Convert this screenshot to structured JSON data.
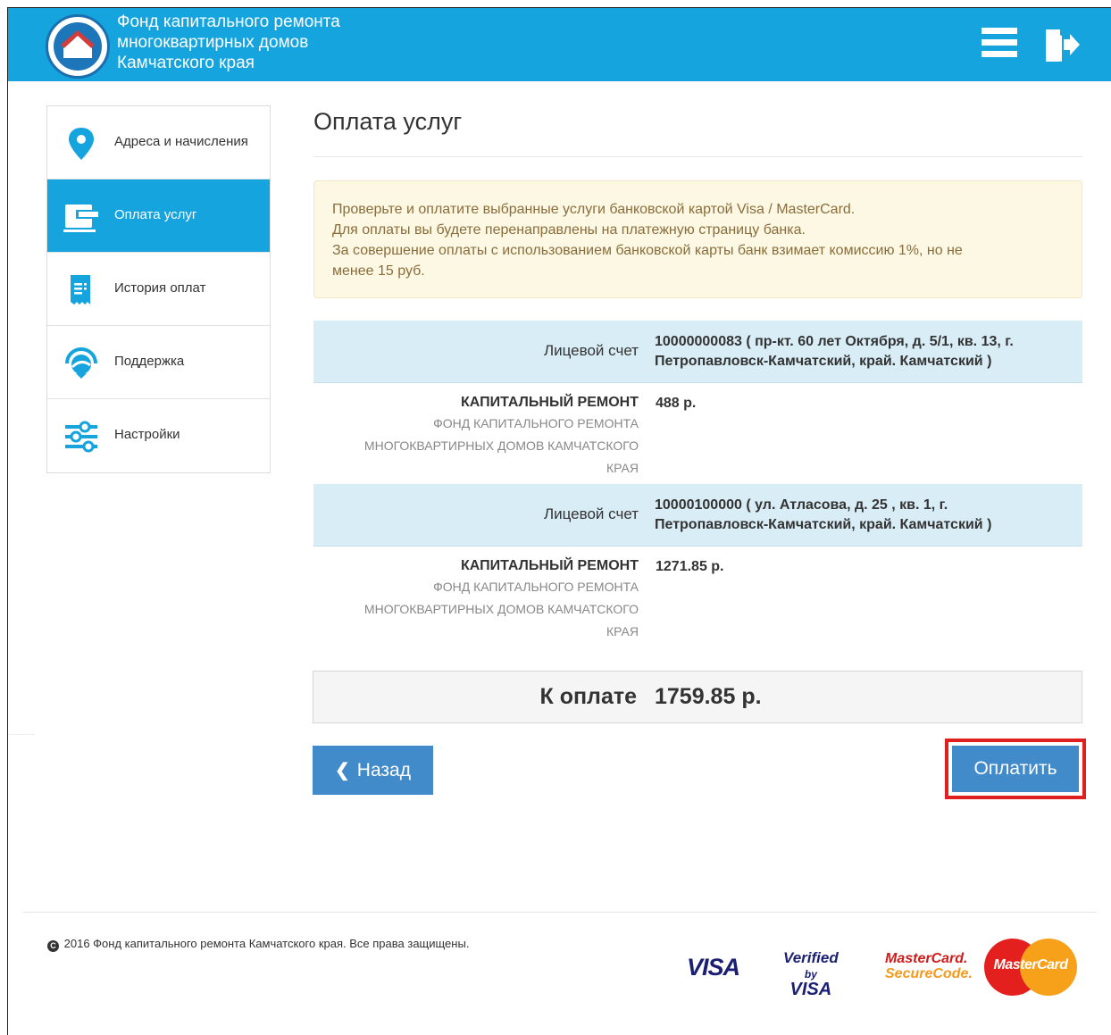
{
  "header": {
    "org_name_line1": "Фонд капитального ремонта",
    "org_name_line2": "многоквартирных домов",
    "org_name_line3": "Камчатского края",
    "brand_color": "#15a4de",
    "menu_icon": "hamburger-menu-icon",
    "logout_icon": "logout-icon"
  },
  "sidebar": {
    "items": [
      {
        "label": "Адреса и начисления",
        "icon": "map-marker-icon",
        "active": false
      },
      {
        "label": "Оплата услуг",
        "icon": "wallet-icon",
        "active": true
      },
      {
        "label": "История оплат",
        "icon": "receipt-icon",
        "active": false
      },
      {
        "label": "Поддержка",
        "icon": "support-headset-icon",
        "active": false
      },
      {
        "label": "Настройки",
        "icon": "sliders-icon",
        "active": false
      }
    ]
  },
  "main": {
    "title": "Оплата услуг",
    "alert": {
      "line1": "Проверьте и оплатите выбранные услуги банковской картой Visa / MasterCard.",
      "line2": "Для оплаты вы будете перенаправлены на платежную страницу банка.",
      "line3": "За совершение оплаты с использованием банковской карты банк взимает комиссию 1%, но не",
      "line4": "менее 15 руб."
    },
    "accounts": [
      {
        "account_label": "Лицевой счет",
        "account_line1": "10000000083 ( пр-кт. 60 лет Октября, д. 5/1,  кв. 13, г.",
        "account_line2": "Петропавловск-Камчатский, край. Камчатский )",
        "service_name": "КАПИТАЛЬНЫЙ РЕМОНТ",
        "service_org_line1": "ФОНД КАПИТАЛЬНОГО РЕМОНТА",
        "service_org_line2": "МНОГОКВАРТИРНЫХ ДОМОВ КАМЧАТСКОГО",
        "service_org_line3": "КРАЯ",
        "amount": "488 р."
      },
      {
        "account_label": "Лицевой счет",
        "account_line1": "10000100000 ( ул. Атласова, д. 25 , кв. 1, г.",
        "account_line2": "Петропавловск-Камчатский, край. Камчатский )",
        "service_name": "КАПИТАЛЬНЫЙ РЕМОНТ",
        "service_org_line1": "ФОНД КАПИТАЛЬНОГО РЕМОНТА",
        "service_org_line2": "МНОГОКВАРТИРНЫХ ДОМОВ КАМЧАТСКОГО",
        "service_org_line3": "КРАЯ",
        "amount": "1271.85 р."
      }
    ],
    "total_label": "К оплате",
    "total_value": "1759.85 р.",
    "back_button": "Назад",
    "pay_button": "Оплатить",
    "highlight_color": "#e0201f"
  },
  "footer": {
    "copyright": "2016 Фонд капитального ремонта Камчатского края. Все права защищены.",
    "logos": {
      "visa": "VISA",
      "vbv_line1": "Verified",
      "vbv_by": "by",
      "vbv_line2": "VISA",
      "msc_line1": "MasterCard.",
      "msc_line2": "SecureCode.",
      "mastercard": "MasterCard"
    }
  }
}
